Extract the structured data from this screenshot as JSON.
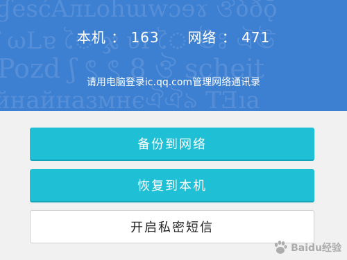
{
  "header": {
    "local_label": "本机",
    "local_count": "163",
    "network_label": "网络",
    "network_count": "471",
    "separator": "：",
    "hint": "请用电脑登录ic.qq.com管理网络通讯录"
  },
  "background_pattern": [
    "ɠesćAлʟohɯwɔɘɤ ঔბðǭ",
    "ʃ ωLɐ ৈ ჯ ʋΓৈ ঊঃ ঐঊ",
    "Pozd ʃ ৎ ৎ 8 ঔ scheit",
    "йнайнаɜмнєঐঐ৯ TƎıa"
  ],
  "actions": {
    "backup": "备份到网络",
    "restore": "恢复到本机",
    "private_sms": "开启私密短信"
  },
  "watermark": {
    "text": "Baidu经验"
  },
  "colors": {
    "header_bg": "#3d7fd1",
    "primary_button": "#1fbfd6",
    "page_bg": "#f1f1f1"
  }
}
